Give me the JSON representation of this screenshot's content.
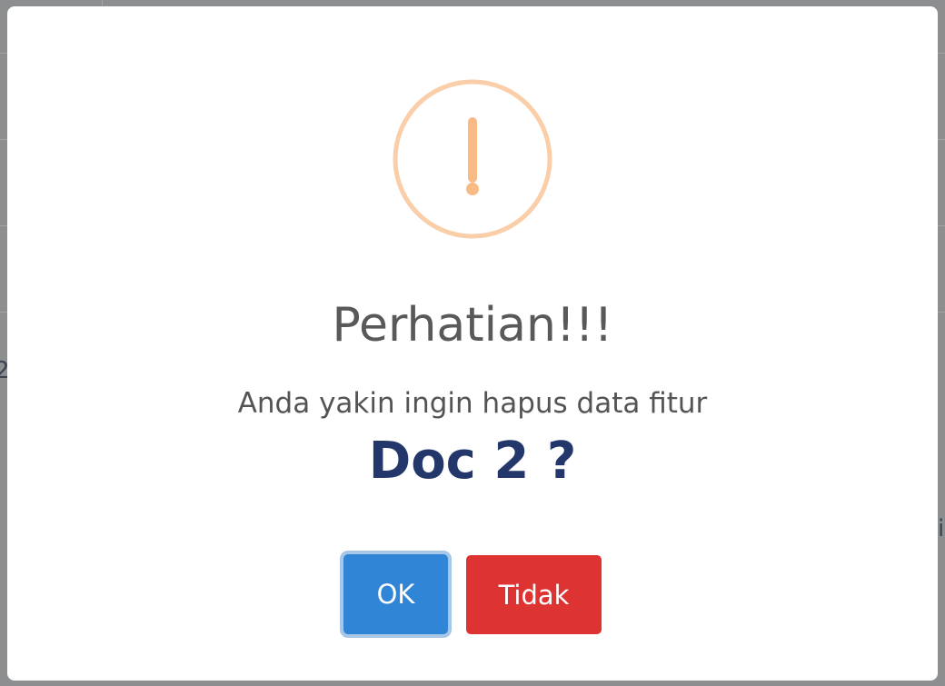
{
  "background": {
    "partial_left": "2",
    "partial_right": "i"
  },
  "dialog": {
    "icon": "warning-exclamation-icon",
    "icon_color": "#f8bb86",
    "title": "Perhatian!!!",
    "message": "Anda yakin ingin hapus data fitur",
    "item": "Doc 2 ?",
    "confirm_label": "OK",
    "cancel_label": "Tidak",
    "confirm_color": "#3085d6",
    "cancel_color": "#dd3333"
  }
}
